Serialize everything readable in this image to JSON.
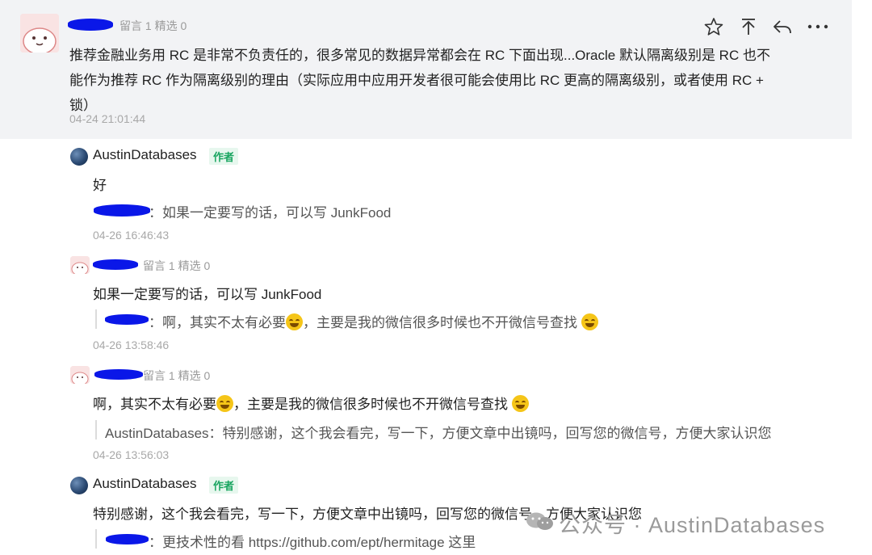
{
  "top_comment": {
    "meta": "留言 1 精选 0",
    "text": "推荐金融业务用 RC 是非常不负责任的，很多常见的数据异常都会在 RC 下面出现...Oracle 默认隔离级别是 RC 也不能作为推荐 RC 作为隔离级别的理由（实际应用中应用开发者很可能会使用比 RC 更高的隔离级别，或者使用 RC + 锁）",
    "time": "04-24 21:01:44",
    "actions": [
      "star-icon",
      "pin-top-icon",
      "reply-icon",
      "more-icon"
    ]
  },
  "replies": [
    {
      "author": "AustinDatabases",
      "badge": "作者",
      "text": "好",
      "quote": "：如果一定要写的话，可以写 JunkFood",
      "time": "04-26 16:46:43"
    },
    {
      "meta": "留言 1 精选 0",
      "text": "如果一定要写的话，可以写 JunkFood",
      "quote_a": "：啊，其实不太有必要",
      "quote_b": "，主要是我的微信很多时候也不开微信号查找 ",
      "time": "04-26 13:58:46"
    },
    {
      "meta": "留言 1 精选 0",
      "text_a": "啊，其实不太有必要",
      "text_b": "，主要是我的微信很多时候也不开微信号查找 ",
      "quote": "AustinDatabases：特别感谢，这个我会看完，写一下，方便文章中出镜吗，回写您的微信号，方便大家认识您",
      "time": "04-26 13:56:03"
    },
    {
      "author": "AustinDatabases",
      "badge": "作者",
      "text": "特别感谢，这个我会看完，写一下，方便文章中出镜吗，回写您的微信号，方便大家认识您",
      "quote": "：更技术性的看 https://github.com/ept/hermitage 这里"
    }
  ],
  "watermark": "公众号 · AustinDatabases",
  "colors": {
    "redaction": "#0a17e8",
    "badge_green": "#19a560",
    "card_bg": "#f2f3f5"
  }
}
